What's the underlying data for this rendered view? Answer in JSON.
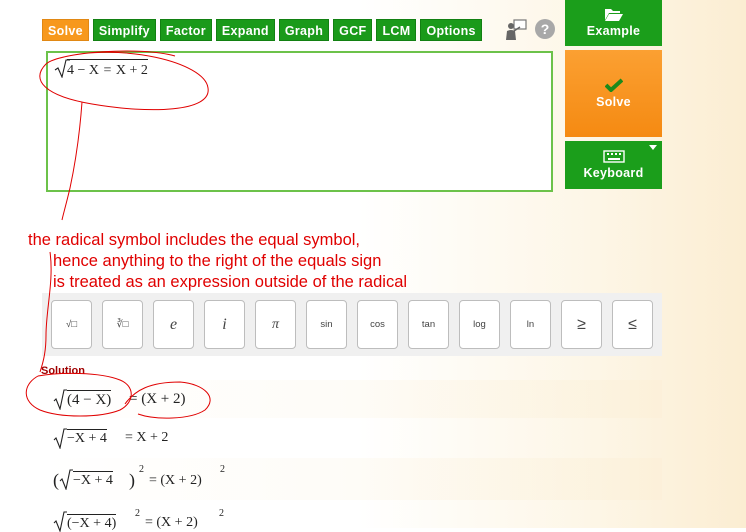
{
  "toolbar": {
    "buttons": [
      "Solve",
      "Simplify",
      "Factor",
      "Expand",
      "Graph",
      "GCF",
      "LCM",
      "Options"
    ],
    "active": "Solve"
  },
  "help": {
    "symbol": "?"
  },
  "side": {
    "example_label": "Example",
    "solve_label": "Solve",
    "keyboard_label": "Keyboard"
  },
  "editor": {
    "radicand": "4 − X",
    "equals": "=",
    "rhs": "X + 2"
  },
  "annotation": {
    "line1": "the radical symbol includes the equal symbol,",
    "line2": "hence anything to the right of the equals sign",
    "line3": "is treated as an expression outside of the radical"
  },
  "keypad": {
    "keys": [
      {
        "label": "√□",
        "name": "sqrt-key"
      },
      {
        "label": "∛□",
        "name": "cube-root-key"
      },
      {
        "label": "e",
        "name": "e-key"
      },
      {
        "label": "i",
        "name": "i-key"
      },
      {
        "label": "π",
        "name": "pi-key"
      },
      {
        "label": "sin",
        "name": "sin-key"
      },
      {
        "label": "cos",
        "name": "cos-key"
      },
      {
        "label": "tan",
        "name": "tan-key"
      },
      {
        "label": "log",
        "name": "log-key"
      },
      {
        "label": "ln",
        "name": "ln-key"
      },
      {
        "label": "≥",
        "name": "gte-key"
      },
      {
        "label": "≤",
        "name": "lte-key"
      }
    ]
  },
  "solution": {
    "label": "Solution",
    "step1": {
      "radicand": "(4 − X)",
      "rhs": "= (X + 2)"
    },
    "step2": {
      "radicand": "−X + 4",
      "rhs": "= X + 2"
    },
    "step3": {
      "radicand": "−X + 4",
      "lhs_exp": "2",
      "rhs": "= (X + 2)",
      "rhs_exp": "2"
    },
    "step4": {
      "radicand": "(−X + 4)",
      "inner_exp": "2",
      "rhs": "= (X + 2)",
      "rhs_exp": "2"
    }
  },
  "colors": {
    "green": "#1b9e1b",
    "orange": "#f7981c",
    "annotation_red": "#e00000"
  }
}
